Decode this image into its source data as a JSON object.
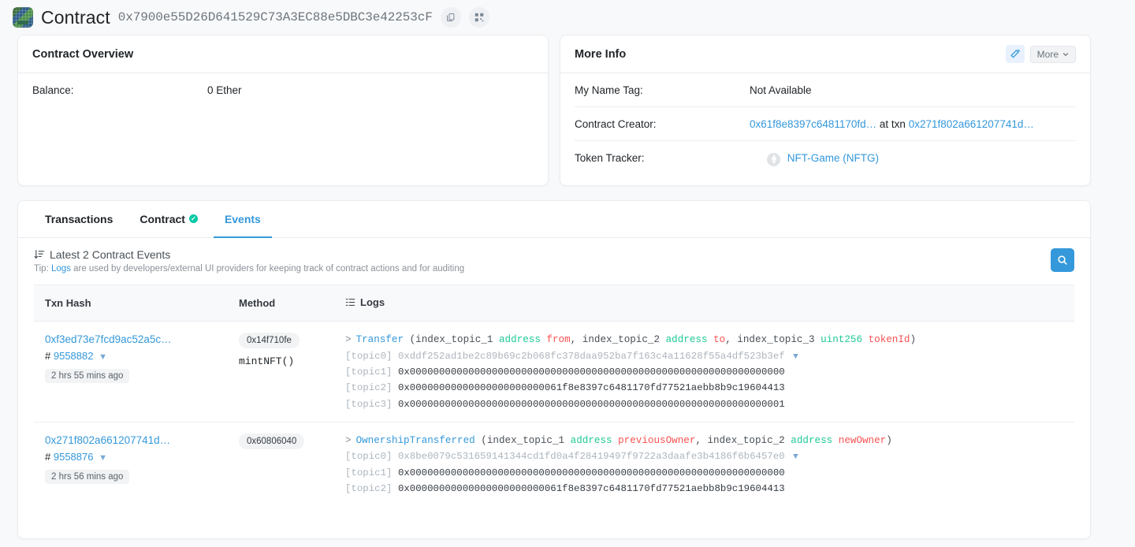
{
  "header": {
    "avatar_icon": "blockie-identicon",
    "title": "Contract",
    "address": "0x7900e55D26D641529C73A3EC88e5DBC3e42253cF",
    "copy_icon": "copy-icon",
    "qr_icon": "qr-code-icon"
  },
  "overview": {
    "title": "Contract Overview",
    "balance_label": "Balance:",
    "balance_value": "0 Ether"
  },
  "more_info": {
    "title": "More Info",
    "wand_icon": "magic-wand-icon",
    "more_label": "More",
    "chevron_icon": "chevron-down-icon",
    "name_tag_label": "My Name Tag:",
    "name_tag_value": "Not Available",
    "creator_label": "Contract Creator:",
    "creator_address": "0x61f8e8397c6481170fd…",
    "creator_at_txn": "at txn",
    "creator_txn": "0x271f802a661207741d…",
    "token_tracker_label": "Token Tracker:",
    "token_icon": "ethereum-token-icon",
    "token_value": "NFT-Game (NFTG)"
  },
  "tabs": [
    {
      "label": "Transactions",
      "active": false,
      "verified": false
    },
    {
      "label": "Contract",
      "active": false,
      "verified": true,
      "verified_icon": "check-circle-icon"
    },
    {
      "label": "Events",
      "active": true,
      "verified": false
    }
  ],
  "events": {
    "sort_icon": "sort-descending-icon",
    "heading": "Latest 2 Contract Events",
    "tip_prefix": "Tip:",
    "tip_link": "Logs",
    "tip_text": "are used by developers/external UI providers for keeping track of contract actions and for auditing",
    "search_icon": "search-icon",
    "columns": {
      "txn_hash": "Txn Hash",
      "method": "Method",
      "logs_icon": "logs-list-icon",
      "logs": "Logs"
    },
    "rows": [
      {
        "txn_hash": "0xf3ed73e7fcd9ac52a5c…",
        "block_prefix": "#",
        "block": "9558882",
        "filter_icon": "funnel-filter-icon",
        "age": "2 hrs 55 mins ago",
        "method_selector": "0x14f710fe",
        "method_name": "mintNFT()",
        "chevron_icon": "chevron-right-icon",
        "event_name": "Transfer",
        "signature": [
          {
            "text": "(",
            "cls": "ix"
          },
          {
            "text": "index_topic_1 ",
            "cls": "ix"
          },
          {
            "text": "address ",
            "cls": "ty"
          },
          {
            "text": "from",
            "cls": "pn"
          },
          {
            "text": ", index_topic_2 ",
            "cls": "ix"
          },
          {
            "text": "address ",
            "cls": "ty"
          },
          {
            "text": "to",
            "cls": "pn"
          },
          {
            "text": ", index_topic_3 ",
            "cls": "ix"
          },
          {
            "text": "uint256 ",
            "cls": "ty"
          },
          {
            "text": "tokenId",
            "cls": "pn"
          },
          {
            "text": ")",
            "cls": "ix"
          }
        ],
        "topics": [
          {
            "label": "[topic0]",
            "value": "0xddf252ad1be2c89b69c2b068fc378daa952ba7f163c4a11628f55a4df523b3ef",
            "muted": true,
            "filter_icon": "funnel-filter-icon"
          },
          {
            "label": "[topic1]",
            "value": "0x0000000000000000000000000000000000000000000000000000000000000000",
            "muted": false
          },
          {
            "label": "[topic2]",
            "value": "0x00000000000000000000000061f8e8397c6481170fd77521aebb8b9c19604413",
            "muted": false
          },
          {
            "label": "[topic3]",
            "value": "0x0000000000000000000000000000000000000000000000000000000000000001",
            "muted": false
          }
        ]
      },
      {
        "txn_hash": "0x271f802a661207741d…",
        "block_prefix": "#",
        "block": "9558876",
        "filter_icon": "funnel-filter-icon",
        "age": "2 hrs 56 mins ago",
        "method_selector": "0x60806040",
        "method_name": "",
        "chevron_icon": "chevron-right-icon",
        "event_name": "OwnershipTransferred",
        "signature": [
          {
            "text": "(",
            "cls": "ix"
          },
          {
            "text": "index_topic_1 ",
            "cls": "ix"
          },
          {
            "text": "address ",
            "cls": "ty"
          },
          {
            "text": "previousOwner",
            "cls": "pn"
          },
          {
            "text": ", index_topic_2 ",
            "cls": "ix"
          },
          {
            "text": "address ",
            "cls": "ty"
          },
          {
            "text": "newOwner",
            "cls": "pn"
          },
          {
            "text": ")",
            "cls": "ix"
          }
        ],
        "topics": [
          {
            "label": "[topic0]",
            "value": "0x8be0079c531659141344cd1fd0a4f28419497f9722a3daafe3b4186f6b6457e0",
            "muted": true,
            "filter_icon": "funnel-filter-icon"
          },
          {
            "label": "[topic1]",
            "value": "0x0000000000000000000000000000000000000000000000000000000000000000",
            "muted": false
          },
          {
            "label": "[topic2]",
            "value": "0x00000000000000000000000061f8e8397c6481170fd77521aebb8b9c19604413",
            "muted": false
          }
        ]
      }
    ]
  },
  "colors": {
    "accent": "#3498db",
    "verified": "#00c9a7",
    "type": "#20c997",
    "param": "#fa5252",
    "muted": "#adb5bd",
    "page_bg": "#f8f9fa"
  }
}
